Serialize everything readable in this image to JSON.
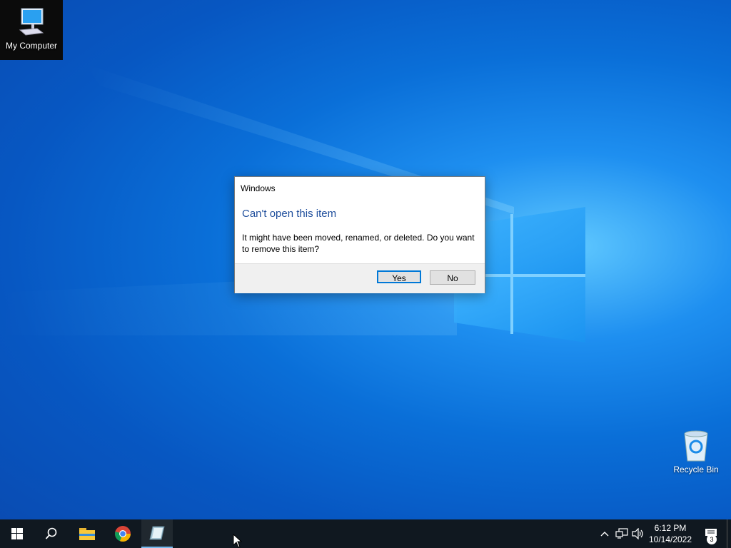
{
  "desktop": {
    "icons": [
      {
        "label": "My Computer",
        "icon": "computer-icon"
      },
      {
        "label": "Recycle Bin",
        "icon": "recycle-bin-icon"
      }
    ]
  },
  "dialog": {
    "title": "Windows",
    "heading": "Can't open this item",
    "message": "It might have been moved, renamed, or deleted. Do you want to remove this item?",
    "yes_label": "Yes",
    "no_label": "No"
  },
  "taskbar": {
    "items": [
      "start-icon",
      "search-icon",
      "file-explorer-icon",
      "chrome-icon",
      "app-icon"
    ],
    "clock_time": "6:12 PM",
    "clock_date": "10/14/2022",
    "notification_count": "3"
  },
  "colors": {
    "accent": "#0078d7",
    "heading": "#1f4e9c",
    "taskbar": "#101820"
  }
}
